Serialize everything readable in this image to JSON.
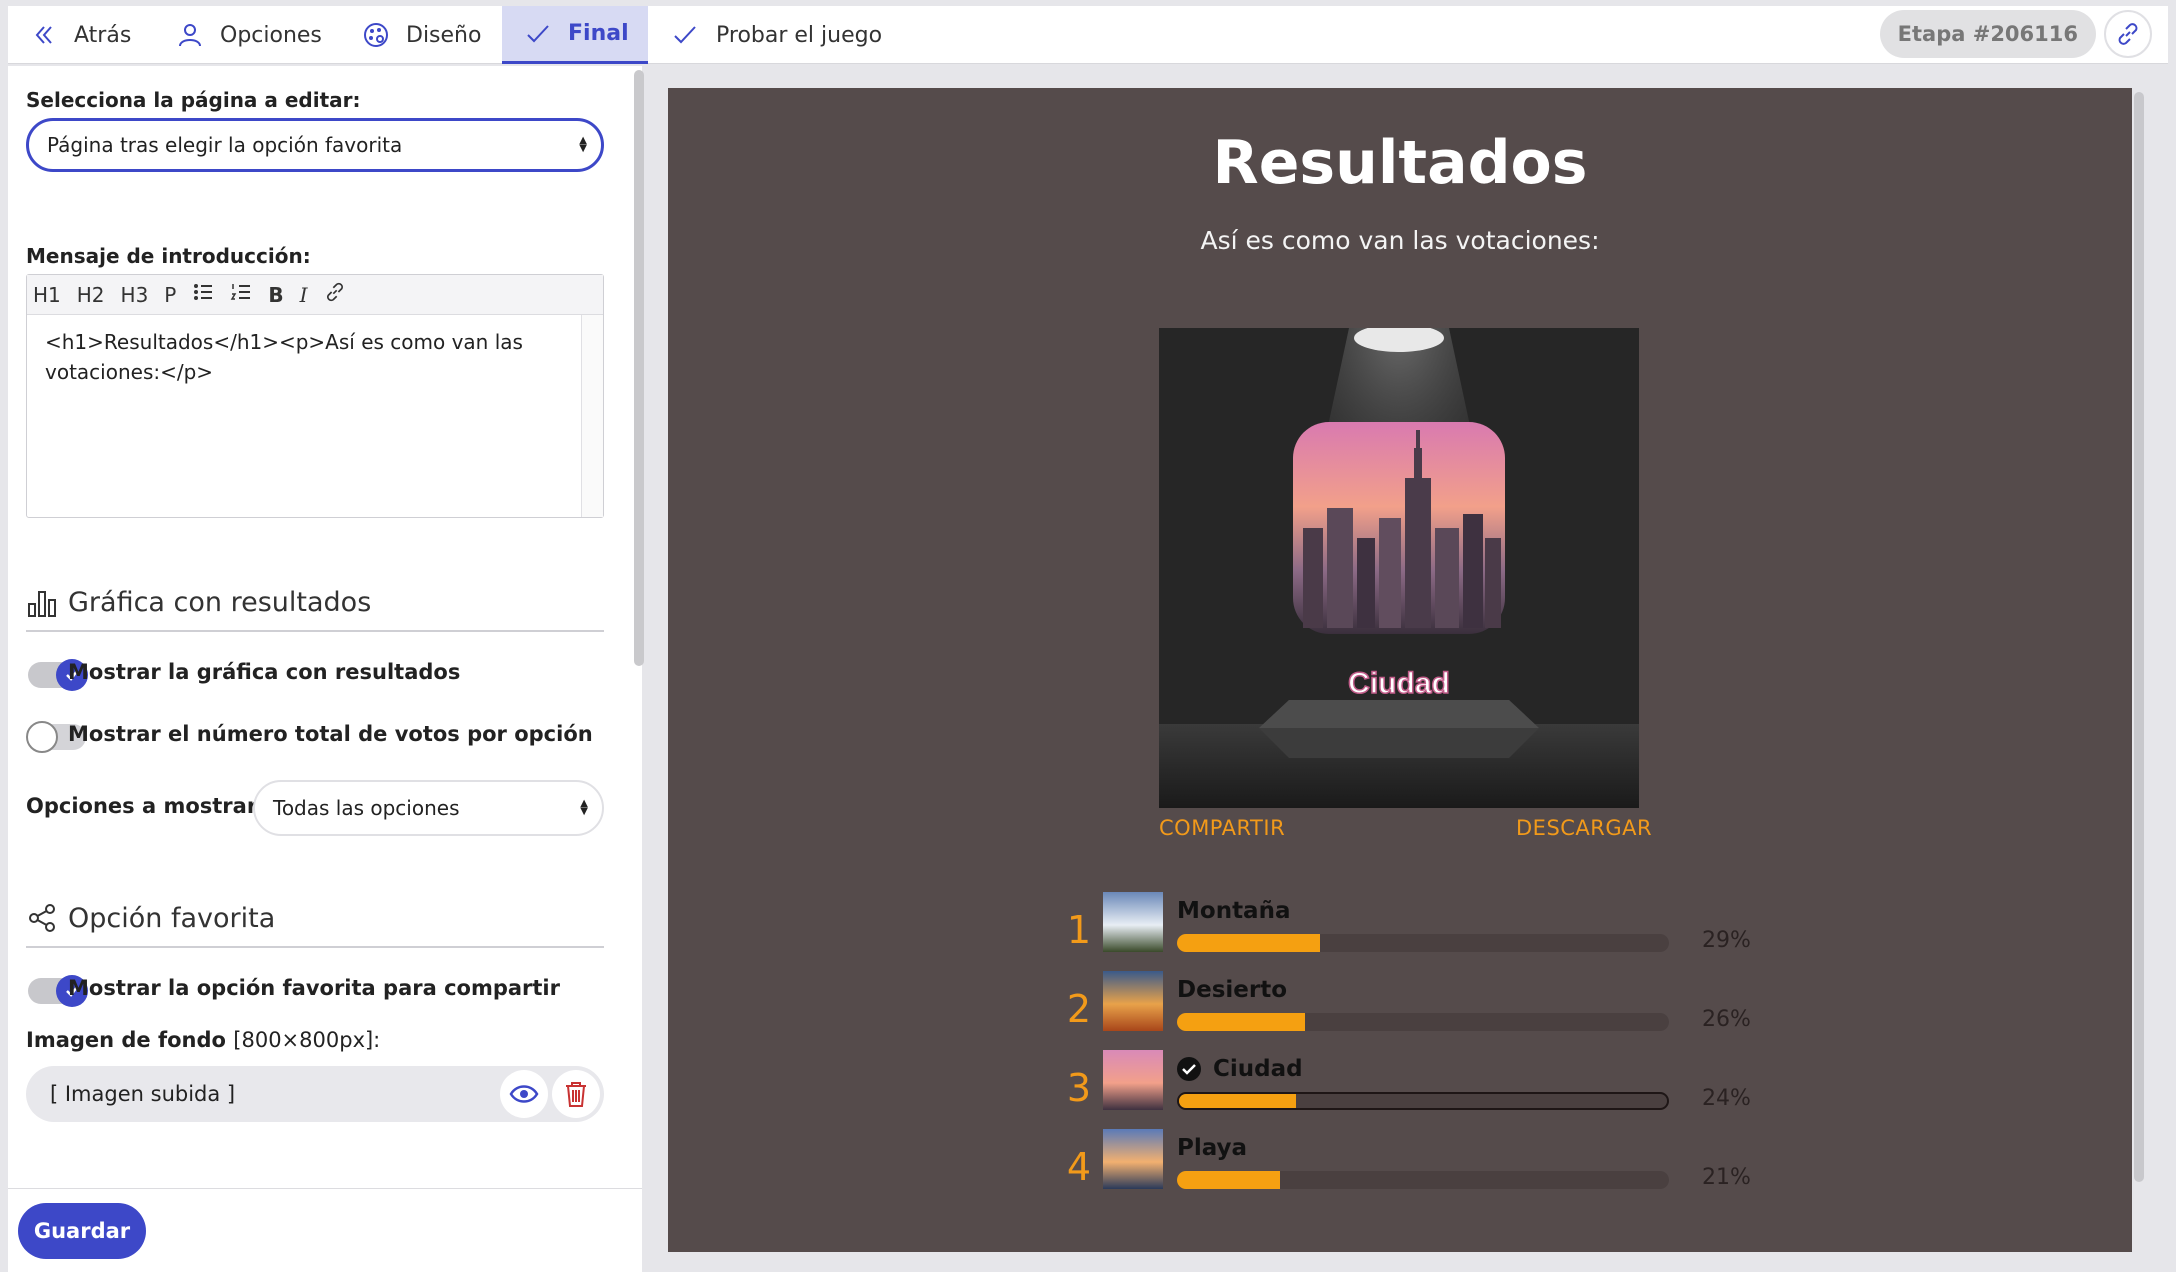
{
  "nav": {
    "back": "Atrás",
    "options": "Opciones",
    "design": "Diseño",
    "final": "Final",
    "test": "Probar el juego",
    "stage_badge": "Etapa #206116"
  },
  "editor_panel": {
    "page_select_label": "Selecciona la página a editar:",
    "page_select_value": "Página tras elegir la opción favorita",
    "intro_label": "Mensaje de introducción:",
    "toolbar": [
      "H1",
      "H2",
      "H3",
      "P"
    ],
    "intro_content": "<h1>Resultados</h1><p>Así es como van las votaciones:</p>",
    "chart_section_title": "Gráfica con resultados",
    "toggle_show_chart": "Mostrar la gráfica con resultados",
    "toggle_show_chart_on": true,
    "toggle_show_votes": "Mostrar el número total de votos por opción",
    "toggle_show_votes_on": false,
    "options_to_show_label": "Opciones a mostrar:",
    "options_to_show_value": "Todas las opciones",
    "favorite_section_title": "Opción favorita",
    "toggle_show_favorite": "Mostrar la opción favorita para compartir",
    "toggle_show_favorite_on": true,
    "bg_image_label": "Imagen de fondo",
    "bg_image_hint": "[800×800px]:",
    "bg_image_value": "[ Imagen subida ]",
    "save_button": "Guardar"
  },
  "preview": {
    "title": "Resultados",
    "subtitle": "Así es como van las votaciones:",
    "featured_label": "Ciudad",
    "share_link": "COMPARTIR",
    "download_link": "DESCARGAR",
    "results": [
      {
        "rank": "1",
        "name": "Montaña",
        "percent": 29,
        "percent_label": "29%",
        "selected": false
      },
      {
        "rank": "2",
        "name": "Desierto",
        "percent": 26,
        "percent_label": "26%",
        "selected": false
      },
      {
        "rank": "3",
        "name": "Ciudad",
        "percent": 24,
        "percent_label": "24%",
        "selected": true
      },
      {
        "rank": "4",
        "name": "Playa",
        "percent": 21,
        "percent_label": "21%",
        "selected": false
      }
    ]
  },
  "colors": {
    "accent": "#3d48c8",
    "preview_bg": "#554b4b",
    "bar": "#f5a011",
    "links": "#f29a1a"
  }
}
